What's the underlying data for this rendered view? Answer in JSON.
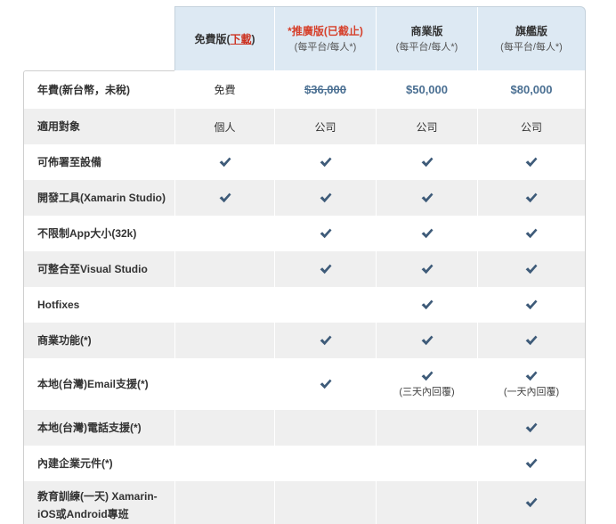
{
  "header": {
    "free": {
      "title_before": "免費版(",
      "link_text": "下載",
      "title_after": ")"
    },
    "plans": [
      {
        "title": "*推廣版(已截止)",
        "subtitle": "(每平台/每人*)"
      },
      {
        "title": "商業版",
        "subtitle": "(每平台/每人*)"
      },
      {
        "title": "旗艦版",
        "subtitle": "(每平台/每人*)"
      }
    ]
  },
  "rows": [
    {
      "label": "年費(新台幣，未稅)",
      "cells": [
        {
          "text": "免費"
        },
        {
          "price": "$36,000",
          "strikethrough": true
        },
        {
          "price": "$50,000"
        },
        {
          "price": "$80,000"
        }
      ]
    },
    {
      "label": "適用對象",
      "cells": [
        {
          "text": "個人"
        },
        {
          "text": "公司"
        },
        {
          "text": "公司"
        },
        {
          "text": "公司"
        }
      ]
    },
    {
      "label": "可佈署至設備",
      "cells": [
        {
          "check": true
        },
        {
          "check": true
        },
        {
          "check": true
        },
        {
          "check": true
        }
      ]
    },
    {
      "label": "開發工具(Xamarin Studio)",
      "cells": [
        {
          "check": true
        },
        {
          "check": true
        },
        {
          "check": true
        },
        {
          "check": true
        }
      ]
    },
    {
      "label": "不限制App大小(32k)",
      "cells": [
        {
          "check": false
        },
        {
          "check": true
        },
        {
          "check": true
        },
        {
          "check": true
        }
      ]
    },
    {
      "label": "可整合至Visual Studio",
      "cells": [
        {
          "check": false
        },
        {
          "check": true
        },
        {
          "check": true
        },
        {
          "check": true
        }
      ]
    },
    {
      "label": "Hotfixes",
      "cells": [
        {
          "check": false
        },
        {
          "check": false
        },
        {
          "check": true
        },
        {
          "check": true
        }
      ]
    },
    {
      "label": "商業功能(*)",
      "cells": [
        {
          "check": false
        },
        {
          "check": true
        },
        {
          "check": true
        },
        {
          "check": true
        }
      ]
    },
    {
      "label": "本地(台灣)Email支援(*)",
      "cells": [
        {
          "check": false
        },
        {
          "check": true
        },
        {
          "check": true,
          "note": "(三天內回覆)"
        },
        {
          "check": true,
          "note": "(一天內回覆)"
        }
      ]
    },
    {
      "label": "本地(台灣)電話支援(*)",
      "cells": [
        {
          "check": false
        },
        {
          "check": false
        },
        {
          "check": false
        },
        {
          "check": true
        }
      ]
    },
    {
      "label": "內建企業元件(*)",
      "cells": [
        {
          "check": false
        },
        {
          "check": false
        },
        {
          "check": false
        },
        {
          "check": true
        }
      ]
    },
    {
      "label": "教育訓練(一天) Xamarin-iOS或Android專班",
      "cells": [
        {
          "check": false
        },
        {
          "check": false
        },
        {
          "check": false
        },
        {
          "check": true
        }
      ]
    }
  ],
  "icons": {
    "check": "check-icon"
  },
  "colors": {
    "header_background": "#dde9f3",
    "alternate_row": "#efefef",
    "promo_title": "#d6402b",
    "download_link": "#cc3322",
    "price": "#4a6f92",
    "check": "#3e5b79"
  }
}
